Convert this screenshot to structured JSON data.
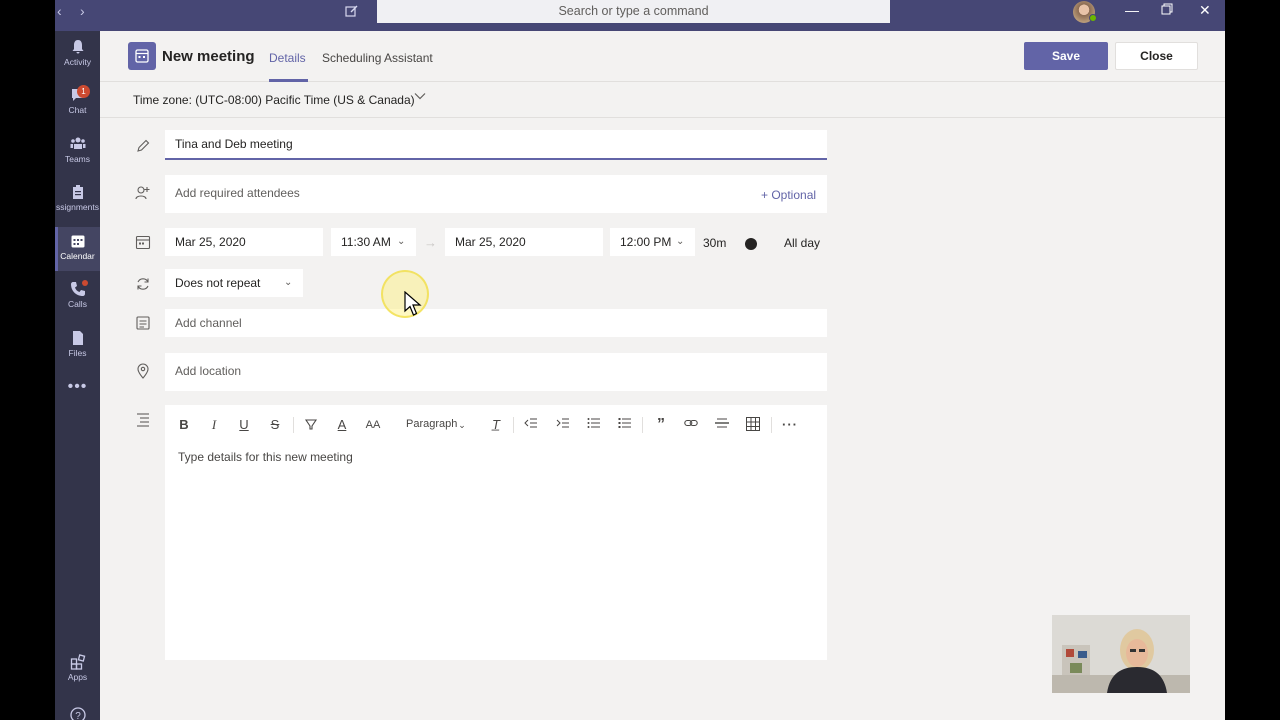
{
  "search": {
    "placeholder": "Search or type a command"
  },
  "rail": [
    {
      "label": "Activity"
    },
    {
      "label": "Chat",
      "badge": "1"
    },
    {
      "label": "Teams"
    },
    {
      "label": "Assignments",
      "display": "ssignments"
    },
    {
      "label": "Calendar"
    },
    {
      "label": "Calls"
    },
    {
      "label": "Files"
    },
    {
      "label": "Apps"
    }
  ],
  "header": {
    "title": "New meeting",
    "tabs": [
      {
        "label": "Details"
      },
      {
        "label": "Scheduling Assistant"
      }
    ],
    "save_label": "Save",
    "close_label": "Close"
  },
  "form": {
    "timezone": "Time zone: (UTC-08:00) Pacific Time (US & Canada)",
    "title_value": "Tina and Deb meeting",
    "attendees_placeholder": "Add required attendees",
    "optional_label": "+ Optional",
    "start_date": "Mar 25, 2020",
    "start_time": "11:30 AM",
    "end_date": "Mar 25, 2020",
    "end_time": "12:00 PM",
    "duration": "30m",
    "all_day_label": "All day",
    "all_day": false,
    "repeat": "Does not repeat",
    "channel_placeholder": "Add channel",
    "location_placeholder": "Add location",
    "details_placeholder": "Type details for this new meeting",
    "paragraph_label": "Paragraph"
  },
  "colors": {
    "accent": "#6264a7",
    "titlebar": "#464775",
    "rail": "#33344a"
  }
}
